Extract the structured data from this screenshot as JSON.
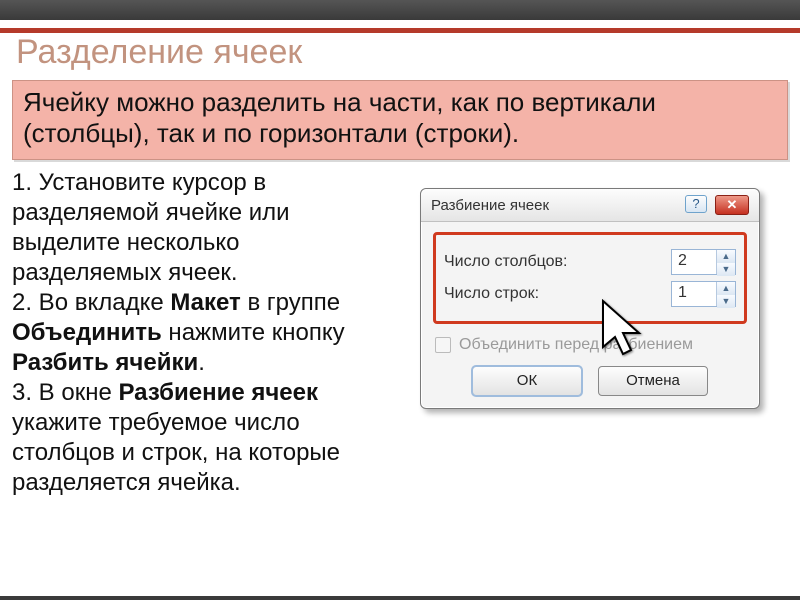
{
  "title": "Разделение ячеек",
  "info": "Ячейку можно разделить на части, как по вертикали (столбцы), так и по горизонтали (строки).",
  "step1": "1. Установите курсор в разделяемой ячейке или выделите несколько разделяемых ячеек.",
  "step2a": "2. Во вкладке ",
  "step2_layout": "Макет",
  "step2b": " в группе ",
  "step2_merge": "Объединить",
  "step2c": " нажмите кнопку ",
  "step2_split": "Разбить ячейки",
  "step2d": ".",
  "step3a": "3. В окне ",
  "step3_dlg": "Разбиение ячеек",
  "step3b": "  укажите требуемое число столбцов и строк, на которые разделяется ячейка.",
  "dialog": {
    "title": "Разбиение ячеек",
    "help": "?",
    "cols_label": "Число столбцов:",
    "cols_value": "2",
    "rows_label": "Число строк:",
    "rows_value": "1",
    "merge_label": "Объединить перед разбиением",
    "ok": "ОК",
    "cancel": "Отмена"
  }
}
